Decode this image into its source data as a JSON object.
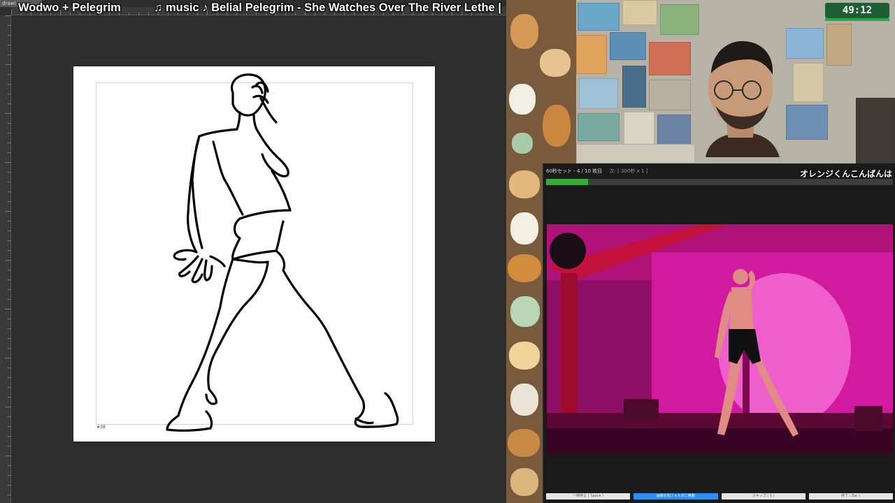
{
  "drawing_app": {
    "tab_label": "drawi",
    "frame_number": "#38"
  },
  "stream_title": {
    "artists": "Wodwo + Pelegrim",
    "now_playing": "♫ music ♪ Belial Pelegrim - She Watches Over The River Lethe |"
  },
  "webcam": {
    "timer": "49:12",
    "timer_color": "#1f5e33"
  },
  "reference_app": {
    "session_label": "60秒セット - 4 / 10 枚目",
    "next_label": "次: [ 300秒 x 1 ]",
    "chat_message": "オレンジくんこんばんは",
    "progress": 0.12,
    "progress_color": "#3aa83a",
    "buttons": [
      {
        "label": "一時停止 ( Space )"
      },
      {
        "label": "画像を別フォルダに移動"
      },
      {
        "label": "スキップ ( S )"
      },
      {
        "label": "終了 ( Esc )"
      }
    ]
  }
}
